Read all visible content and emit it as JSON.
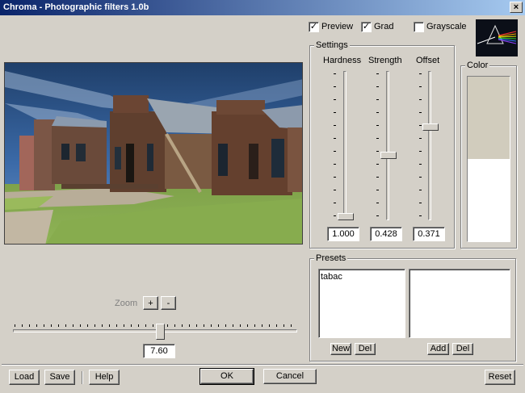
{
  "window": {
    "title": "Chroma - Photographic filters 1.0b",
    "close_glyph": "×"
  },
  "options": {
    "preview_label": "Preview",
    "preview_checked": true,
    "grad_label": "Grad",
    "grad_checked": true,
    "grayscale_label": "Grayscale",
    "grayscale_checked": false
  },
  "settings": {
    "label": "Settings",
    "hardness": {
      "label": "Hardness",
      "value": "1.000"
    },
    "strength": {
      "label": "Strength",
      "value": "0.428"
    },
    "offset": {
      "label": "Offset",
      "value": "0.371"
    }
  },
  "color": {
    "label": "Color",
    "top_color": "#d1ccbd",
    "bottom_color": "#ffffff"
  },
  "zoom": {
    "label": "Zoom",
    "plus": "+",
    "minus": "-",
    "value": "7.60"
  },
  "presets": {
    "label": "Presets",
    "list_left": [
      "tabac"
    ],
    "list_right": [],
    "new_label": "New",
    "del_left_label": "Del",
    "add_label": "Add",
    "del_right_label": "Del"
  },
  "buttons": {
    "load": "Load",
    "save": "Save",
    "help": "Help",
    "ok": "OK",
    "cancel": "Cancel",
    "reset": "Reset"
  }
}
